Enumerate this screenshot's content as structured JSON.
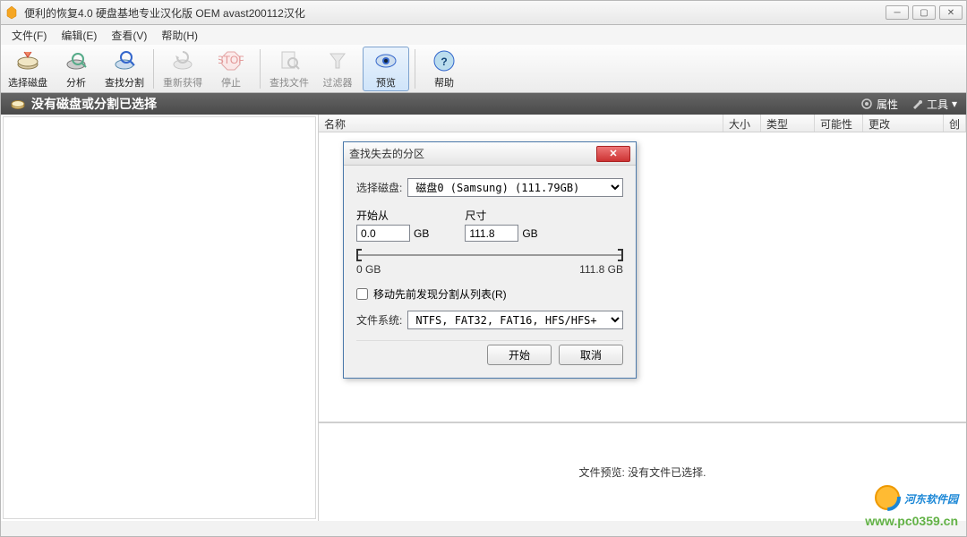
{
  "window": {
    "title": "便利的恢复4.0 硬盘基地专业汉化版 OEM avast200112汉化"
  },
  "menu": {
    "file": "文件(F)",
    "edit": "编辑(E)",
    "view": "查看(V)",
    "help": "帮助(H)"
  },
  "toolbar": {
    "select_disk": "选择磁盘",
    "analyze": "分析",
    "find_partition": "查找分割",
    "reget": "重新获得",
    "stop": "停止",
    "find_file": "查找文件",
    "filter": "过滤器",
    "preview": "预览",
    "help": "帮助"
  },
  "statusbar": {
    "title": "没有磁盘或分割已选择",
    "props": "属性",
    "tools": "工具"
  },
  "columns": {
    "name": "名称",
    "size": "大小",
    "type": "类型",
    "possibility": "可能性",
    "modified": "更改",
    "created": "创造的"
  },
  "preview": {
    "text": "文件预览: 没有文件已选择."
  },
  "dialog": {
    "title": "查找失去的分区",
    "select_disk_label": "选择磁盘:",
    "disk_value": "磁盘0 (Samsung) (111.79GB)",
    "start_label": "开始从",
    "start_value": "0.0",
    "start_unit": "GB",
    "size_label": "尺寸",
    "size_value": "111.8",
    "size_unit": "GB",
    "slider_min": "0 GB",
    "slider_max": "111.8 GB",
    "checkbox_label": "移动先前发现分割从列表(R)",
    "fs_label": "文件系统:",
    "fs_value": "NTFS, FAT32, FAT16, HFS/HFS+",
    "start_btn": "开始",
    "cancel_btn": "取消"
  },
  "watermark": {
    "name": "河东软件园",
    "url": "www.pc0359.cn"
  }
}
